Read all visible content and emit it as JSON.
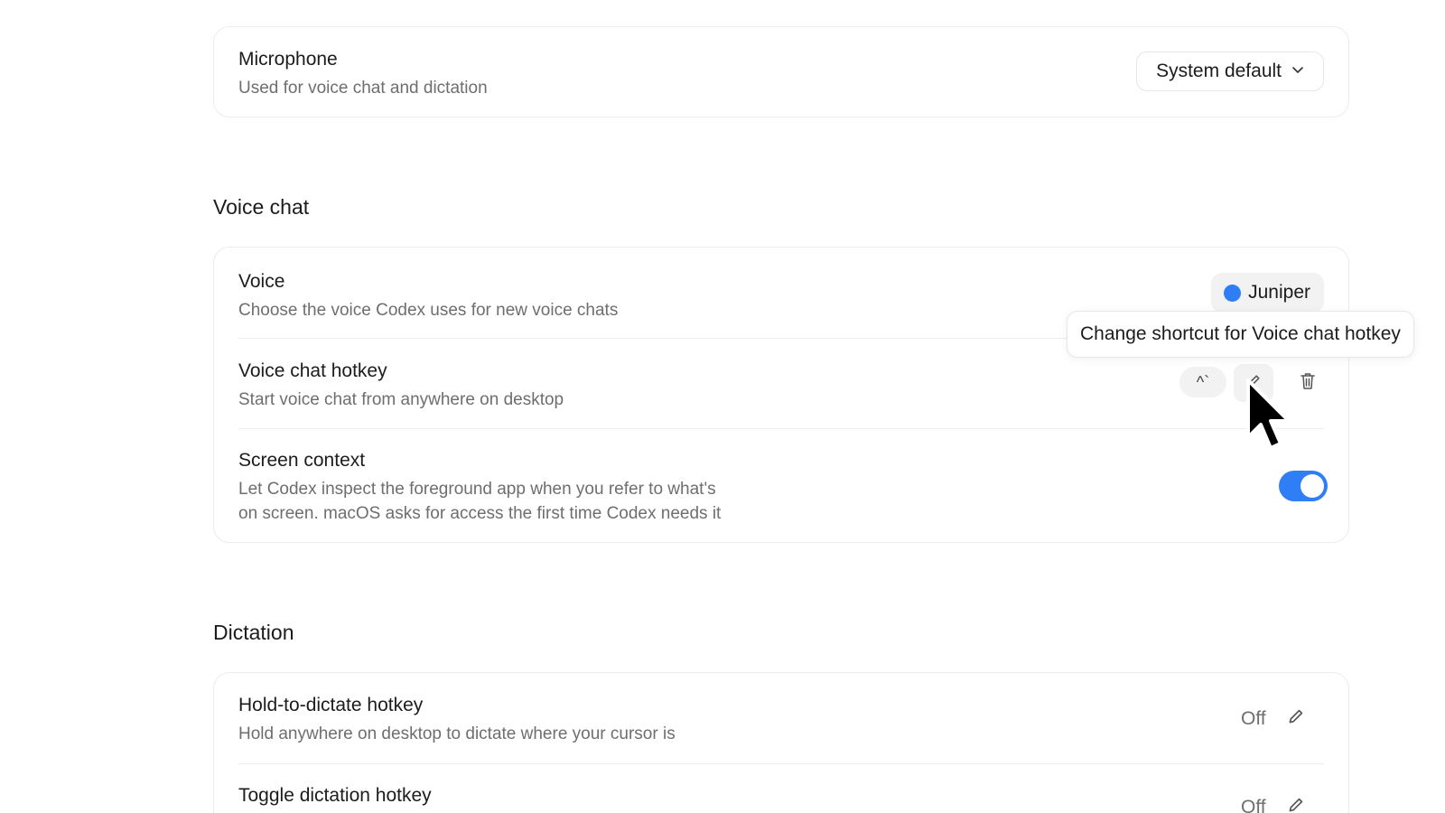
{
  "microphone": {
    "title": "Microphone",
    "description": "Used for voice chat and dictation",
    "selected": "System default"
  },
  "voice_chat": {
    "heading": "Voice chat",
    "voice": {
      "title": "Voice",
      "description": "Choose the voice Codex uses for new voice chats",
      "selected": "Juniper",
      "color": "#2f7ef5"
    },
    "hotkey": {
      "title": "Voice chat hotkey",
      "description": "Start voice chat from anywhere on desktop",
      "shortcut": "^`",
      "tooltip": "Change shortcut for Voice chat hotkey"
    },
    "screen_context": {
      "title": "Screen context",
      "description_line1": "Let Codex inspect the foreground app when you refer to what's",
      "description_line2": "on screen. macOS asks for access the first time Codex needs it",
      "enabled": true
    }
  },
  "dictation": {
    "heading": "Dictation",
    "hold_hotkey": {
      "title": "Hold-to-dictate hotkey",
      "description": "Hold anywhere on desktop to dictate where your cursor is",
      "value": "Off"
    },
    "toggle_hotkey": {
      "title": "Toggle dictation hotkey",
      "value": "Off"
    }
  },
  "colors": {
    "accent": "#2f7ef5",
    "border": "#ececec",
    "muted_text": "#6e6e6e"
  },
  "icons": [
    "chevron-down-icon",
    "pencil-icon",
    "trash-icon",
    "cursor-pointer-icon"
  ]
}
